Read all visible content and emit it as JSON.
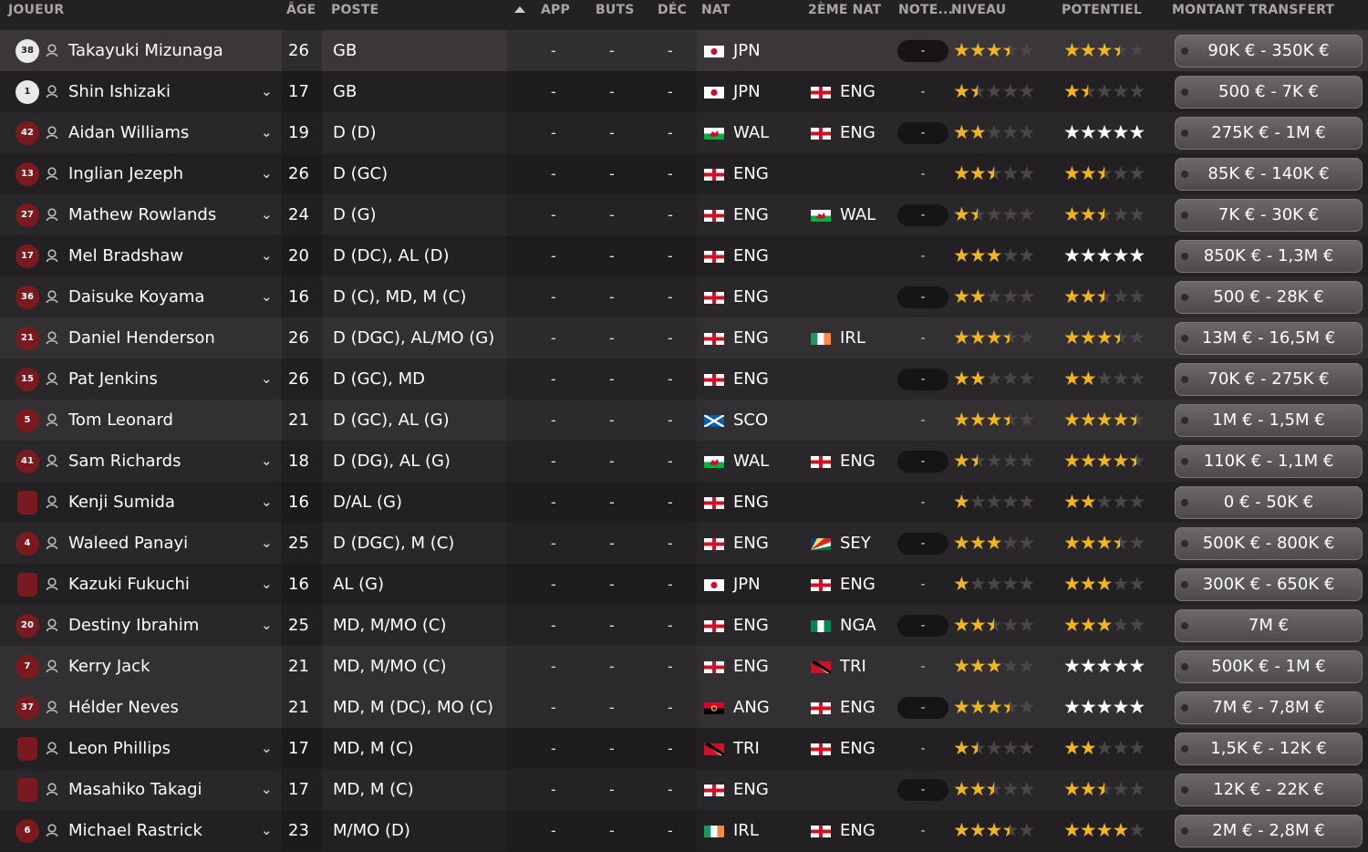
{
  "headers": {
    "player": "JOUEUR",
    "age": "ÂGE",
    "position": "POSTE",
    "apps": "APP",
    "goals": "BUTS",
    "dec": "DÉC",
    "nat": "NAT",
    "second_nat": "2ÈME NAT",
    "rating": "NOTE...",
    "level": "NIVEAU",
    "potential": "POTENTIEL",
    "transfer_value": "MONTANT TRANSFERT"
  },
  "colors": {
    "star_on": "#f2b51d",
    "star_off": "#4a4649",
    "star_white": "#ffffff",
    "shirt_red": "#7a1a1e"
  },
  "players": [
    {
      "shirt": "38",
      "gk": true,
      "name": "Takayuki Mizunaga",
      "chevron": false,
      "age": "26",
      "position": "GB",
      "apps": "-",
      "goals": "-",
      "dec": "-",
      "nat": "JPN",
      "nat2": "",
      "rating": "-",
      "level": 3.5,
      "potential": 3.5,
      "value": "90K € - 350K €"
    },
    {
      "shirt": "1",
      "gk": true,
      "name": "Shin Ishizaki",
      "chevron": true,
      "age": "17",
      "position": "GB",
      "apps": "-",
      "goals": "-",
      "dec": "-",
      "nat": "JPN",
      "nat2": "ENG",
      "rating": "-",
      "level": 1.5,
      "potential": 1.5,
      "value": "500 € - 7K €"
    },
    {
      "shirt": "42",
      "gk": false,
      "name": "Aidan Williams",
      "chevron": true,
      "age": "19",
      "position": "D (D)",
      "apps": "-",
      "goals": "-",
      "dec": "-",
      "nat": "WAL",
      "nat2": "ENG",
      "rating": "-",
      "level": 2,
      "potential": 5,
      "value": "275K € - 1M €"
    },
    {
      "shirt": "13",
      "gk": false,
      "name": "Inglian Jezeph",
      "chevron": true,
      "age": "26",
      "position": "D (GC)",
      "apps": "-",
      "goals": "-",
      "dec": "-",
      "nat": "ENG",
      "nat2": "",
      "rating": "-",
      "level": 2.5,
      "potential": 2.5,
      "value": "85K € - 140K €"
    },
    {
      "shirt": "27",
      "gk": false,
      "name": "Mathew Rowlands",
      "chevron": true,
      "age": "24",
      "position": "D (G)",
      "apps": "-",
      "goals": "-",
      "dec": "-",
      "nat": "ENG",
      "nat2": "WAL",
      "rating": "-",
      "level": 1.5,
      "potential": 2.5,
      "value": "7K € - 30K €"
    },
    {
      "shirt": "17",
      "gk": false,
      "name": "Mel Bradshaw",
      "chevron": true,
      "age": "20",
      "position": "D (DC), AL (D)",
      "apps": "-",
      "goals": "-",
      "dec": "-",
      "nat": "ENG",
      "nat2": "",
      "rating": "-",
      "level": 3,
      "potential": 5,
      "value": "850K € - 1,3M €"
    },
    {
      "shirt": "36",
      "gk": false,
      "name": "Daisuke Koyama",
      "chevron": true,
      "age": "16",
      "position": "D (C), MD, M (C)",
      "apps": "-",
      "goals": "-",
      "dec": "-",
      "nat": "ENG",
      "nat2": "",
      "rating": "-",
      "level": 2,
      "potential": 2.5,
      "value": "500 € - 28K €"
    },
    {
      "shirt": "21",
      "gk": false,
      "name": "Daniel Henderson",
      "chevron": false,
      "age": "26",
      "position": "D (DGC), AL/MO (G)",
      "apps": "-",
      "goals": "-",
      "dec": "-",
      "nat": "ENG",
      "nat2": "IRL",
      "rating": "-",
      "level": 3.5,
      "potential": 3.5,
      "value": "13M € - 16,5M €"
    },
    {
      "shirt": "15",
      "gk": false,
      "name": "Pat Jenkins",
      "chevron": true,
      "age": "26",
      "position": "D (GC), MD",
      "apps": "-",
      "goals": "-",
      "dec": "-",
      "nat": "ENG",
      "nat2": "",
      "rating": "-",
      "level": 2,
      "potential": 2,
      "value": "70K € - 275K €"
    },
    {
      "shirt": "5",
      "gk": false,
      "name": "Tom Leonard",
      "chevron": false,
      "age": "21",
      "position": "D (GC), AL (G)",
      "apps": "-",
      "goals": "-",
      "dec": "-",
      "nat": "SCO",
      "nat2": "",
      "rating": "-",
      "level": 3.5,
      "potential": 4.5,
      "value": "1M € - 1,5M €"
    },
    {
      "shirt": "41",
      "gk": false,
      "name": "Sam Richards",
      "chevron": true,
      "age": "18",
      "position": "D (DG), AL (G)",
      "apps": "-",
      "goals": "-",
      "dec": "-",
      "nat": "WAL",
      "nat2": "ENG",
      "rating": "-",
      "level": 1.5,
      "potential": 4.5,
      "value": "110K € - 1,1M €"
    },
    {
      "shirt": "",
      "gk": false,
      "name": "Kenji Sumida",
      "chevron": true,
      "age": "16",
      "position": "D/AL (G)",
      "apps": "-",
      "goals": "-",
      "dec": "-",
      "nat": "ENG",
      "nat2": "",
      "rating": "-",
      "level": 1,
      "potential": 2,
      "value": "0 € - 50K €"
    },
    {
      "shirt": "4",
      "gk": false,
      "name": "Waleed Panayi",
      "chevron": true,
      "age": "25",
      "position": "D (DGC), M (C)",
      "apps": "-",
      "goals": "-",
      "dec": "-",
      "nat": "ENG",
      "nat2": "SEY",
      "rating": "-",
      "level": 3,
      "potential": 3.5,
      "value": "500K € - 800K €"
    },
    {
      "shirt": "",
      "gk": false,
      "name": "Kazuki Fukuchi",
      "chevron": true,
      "age": "16",
      "position": "AL (G)",
      "apps": "-",
      "goals": "-",
      "dec": "-",
      "nat": "JPN",
      "nat2": "ENG",
      "rating": "-",
      "level": 1,
      "potential": 3,
      "value": "300K € - 650K €"
    },
    {
      "shirt": "20",
      "gk": false,
      "name": "Destiny Ibrahim",
      "chevron": true,
      "age": "25",
      "position": "MD, M/MO (C)",
      "apps": "-",
      "goals": "-",
      "dec": "-",
      "nat": "ENG",
      "nat2": "NGA",
      "rating": "-",
      "level": 2.5,
      "potential": 3,
      "value": "7M €"
    },
    {
      "shirt": "7",
      "gk": false,
      "name": "Kerry Jack",
      "chevron": false,
      "age": "21",
      "position": "MD, M/MO (C)",
      "apps": "-",
      "goals": "-",
      "dec": "-",
      "nat": "ENG",
      "nat2": "TRI",
      "rating": "-",
      "level": 3,
      "potential": 5,
      "value": "500K € - 1M €"
    },
    {
      "shirt": "37",
      "gk": false,
      "name": "Hélder Neves",
      "chevron": false,
      "age": "21",
      "position": "MD, M (DC), MO (C)",
      "apps": "-",
      "goals": "-",
      "dec": "-",
      "nat": "ANG",
      "nat2": "ENG",
      "rating": "-",
      "level": 3.5,
      "potential": 5,
      "value": "7M € - 7,8M €"
    },
    {
      "shirt": "",
      "gk": false,
      "name": "Leon Phillips",
      "chevron": true,
      "age": "17",
      "position": "MD, M (C)",
      "apps": "-",
      "goals": "-",
      "dec": "-",
      "nat": "TRI",
      "nat2": "ENG",
      "rating": "-",
      "level": 1.5,
      "potential": 2,
      "value": "1,5K € - 12K €"
    },
    {
      "shirt": "",
      "gk": false,
      "name": "Masahiko Takagi",
      "chevron": true,
      "age": "17",
      "position": "MD, M (C)",
      "apps": "-",
      "goals": "-",
      "dec": "-",
      "nat": "ENG",
      "nat2": "",
      "rating": "-",
      "level": 2.5,
      "potential": 2.5,
      "value": "12K € - 22K €"
    },
    {
      "shirt": "6",
      "gk": false,
      "name": "Michael Rastrick",
      "chevron": true,
      "age": "23",
      "position": "M/MO (D)",
      "apps": "-",
      "goals": "-",
      "dec": "-",
      "nat": "IRL",
      "nat2": "ENG",
      "rating": "-",
      "level": 3.5,
      "potential": 4,
      "value": "2M € - 2,8M €"
    }
  ]
}
